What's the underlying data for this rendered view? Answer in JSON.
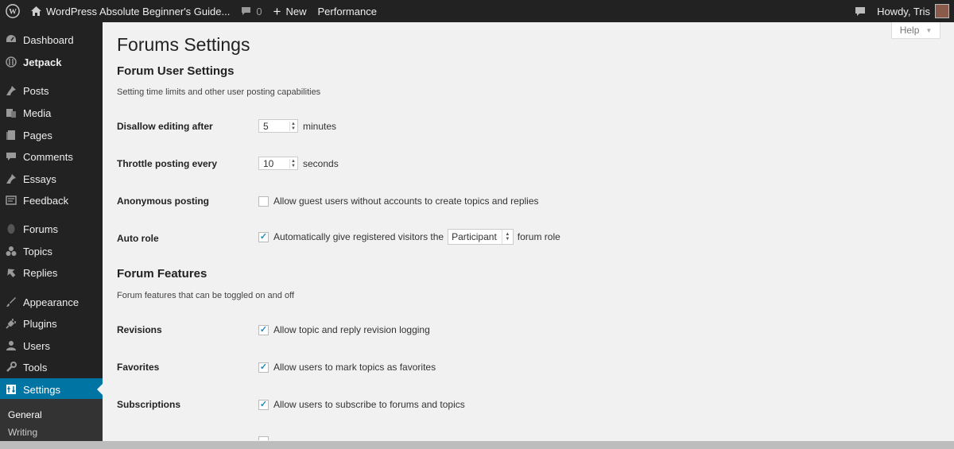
{
  "adminbar": {
    "site_name": "WordPress Absolute Beginner's Guide...",
    "comments_count": "0",
    "new_label": "New",
    "performance_label": "Performance",
    "howdy": "Howdy, Tris"
  },
  "sidebar": {
    "items": [
      {
        "label": "Dashboard",
        "icon": "dashboard-icon"
      },
      {
        "label": "Jetpack",
        "icon": "jetpack-icon"
      },
      {
        "label": "Posts",
        "icon": "pin-icon"
      },
      {
        "label": "Media",
        "icon": "media-icon"
      },
      {
        "label": "Pages",
        "icon": "pages-icon"
      },
      {
        "label": "Comments",
        "icon": "comment-icon"
      },
      {
        "label": "Essays",
        "icon": "pin-icon"
      },
      {
        "label": "Feedback",
        "icon": "feedback-icon"
      },
      {
        "label": "Forums",
        "icon": "forums-icon"
      },
      {
        "label": "Topics",
        "icon": "topics-icon"
      },
      {
        "label": "Replies",
        "icon": "replies-icon"
      },
      {
        "label": "Appearance",
        "icon": "brush-icon"
      },
      {
        "label": "Plugins",
        "icon": "plug-icon"
      },
      {
        "label": "Users",
        "icon": "user-icon"
      },
      {
        "label": "Tools",
        "icon": "wrench-icon"
      },
      {
        "label": "Settings",
        "icon": "settings-icon"
      }
    ],
    "submenu": [
      "General",
      "Writing"
    ]
  },
  "help_label": "Help",
  "page_title": "Forums Settings",
  "user_settings": {
    "heading": "Forum User Settings",
    "description": "Setting time limits and other user posting capabilities",
    "disallow_label": "Disallow editing after",
    "disallow_value": "5",
    "disallow_unit": "minutes",
    "throttle_label": "Throttle posting every",
    "throttle_value": "10",
    "throttle_unit": "seconds",
    "anonymous_label": "Anonymous posting",
    "anonymous_text": "Allow guest users without accounts to create topics and replies",
    "anonymous_checked": false,
    "autorole_label": "Auto role",
    "autorole_text_before": "Automatically give registered visitors the",
    "autorole_select": "Participant",
    "autorole_text_after": "forum role",
    "autorole_checked": true
  },
  "features": {
    "heading": "Forum Features",
    "description": "Forum features that can be toggled on and off",
    "revisions_label": "Revisions",
    "revisions_text": "Allow topic and reply revision logging",
    "revisions_checked": true,
    "favorites_label": "Favorites",
    "favorites_text": "Allow users to mark topics as favorites",
    "favorites_checked": true,
    "subscriptions_label": "Subscriptions",
    "subscriptions_text": "Allow users to subscribe to forums and topics",
    "subscriptions_checked": true
  },
  "colors": {
    "adminbar_bg": "#222222",
    "current_menu_bg": "#0074a2",
    "checkmark": "#1e8cbe"
  }
}
